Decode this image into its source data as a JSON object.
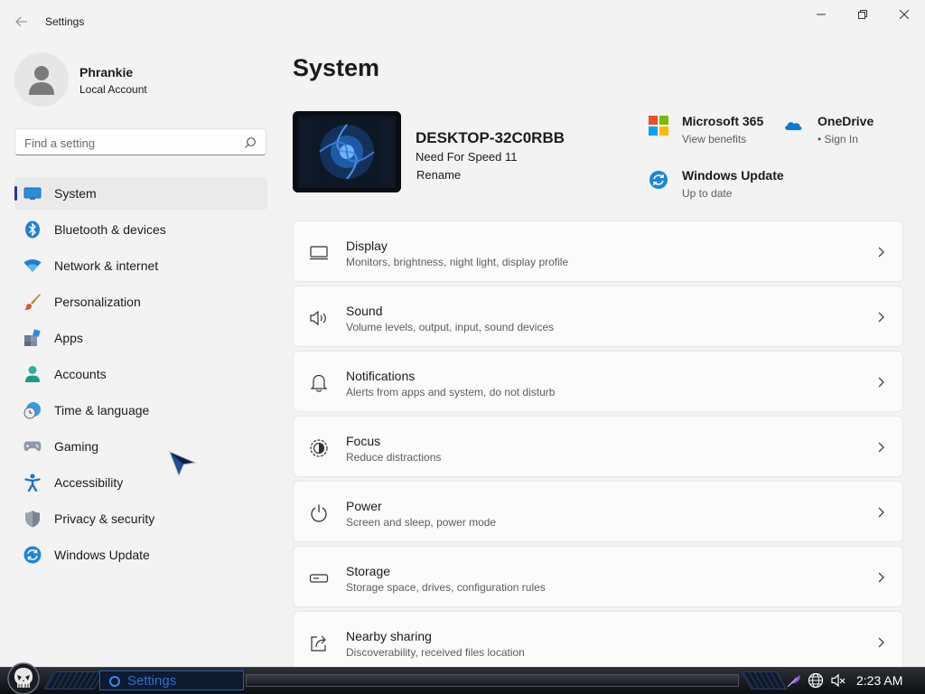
{
  "window": {
    "title": "Settings",
    "back_icon": "arrow-left-icon",
    "controls": [
      "minimize-icon",
      "maximize-icon",
      "close-icon"
    ]
  },
  "profile": {
    "name": "Phrankie",
    "account_type": "Local Account"
  },
  "search": {
    "placeholder": "Find a setting"
  },
  "sidebar": {
    "items": [
      {
        "label": "System",
        "icon": "monitor-icon",
        "active": true
      },
      {
        "label": "Bluetooth & devices",
        "icon": "bluetooth-icon"
      },
      {
        "label": "Network & internet",
        "icon": "wifi-icon"
      },
      {
        "label": "Personalization",
        "icon": "paintbrush-icon"
      },
      {
        "label": "Apps",
        "icon": "apps-icon"
      },
      {
        "label": "Accounts",
        "icon": "person-icon"
      },
      {
        "label": "Time & language",
        "icon": "clock-globe-icon"
      },
      {
        "label": "Gaming",
        "icon": "gamepad-icon"
      },
      {
        "label": "Accessibility",
        "icon": "accessibility-icon"
      },
      {
        "label": "Privacy & security",
        "icon": "shield-icon"
      },
      {
        "label": "Windows Update",
        "icon": "update-icon"
      }
    ]
  },
  "main": {
    "title": "System",
    "device": {
      "name": "DESKTOP-32C0RBB",
      "model": "Need For Speed 11",
      "rename_label": "Rename"
    },
    "quick_links": [
      {
        "title": "Microsoft 365",
        "subtitle": "View benefits",
        "icon": "microsoft-logo-icon"
      },
      {
        "title": "OneDrive",
        "subtitle": "• Sign In",
        "icon": "onedrive-cloud-icon"
      },
      {
        "title": "Windows Update",
        "subtitle": "Up to date",
        "icon": "update-icon"
      }
    ],
    "cards": [
      {
        "title": "Display",
        "subtitle": "Monitors, brightness, night light, display profile",
        "icon": "display-icon"
      },
      {
        "title": "Sound",
        "subtitle": "Volume levels, output, input, sound devices",
        "icon": "speaker-icon"
      },
      {
        "title": "Notifications",
        "subtitle": "Alerts from apps and system, do not disturb",
        "icon": "bell-icon"
      },
      {
        "title": "Focus",
        "subtitle": "Reduce distractions",
        "icon": "focus-icon"
      },
      {
        "title": "Power",
        "subtitle": "Screen and sleep, power mode",
        "icon": "power-icon"
      },
      {
        "title": "Storage",
        "subtitle": "Storage space, drives, configuration rules",
        "icon": "storage-icon"
      },
      {
        "title": "Nearby sharing",
        "subtitle": "Discoverability, received files location",
        "icon": "share-icon"
      }
    ]
  },
  "taskbar": {
    "task_label": "Settings",
    "clock": "2:23 AM",
    "tray_icons": [
      "feather-icon",
      "globe-network-icon",
      "volume-muted-icon"
    ]
  },
  "colors": {
    "accent": "#1f3a8a",
    "background": "#f3f3f3",
    "card": "#fbfbfb"
  }
}
